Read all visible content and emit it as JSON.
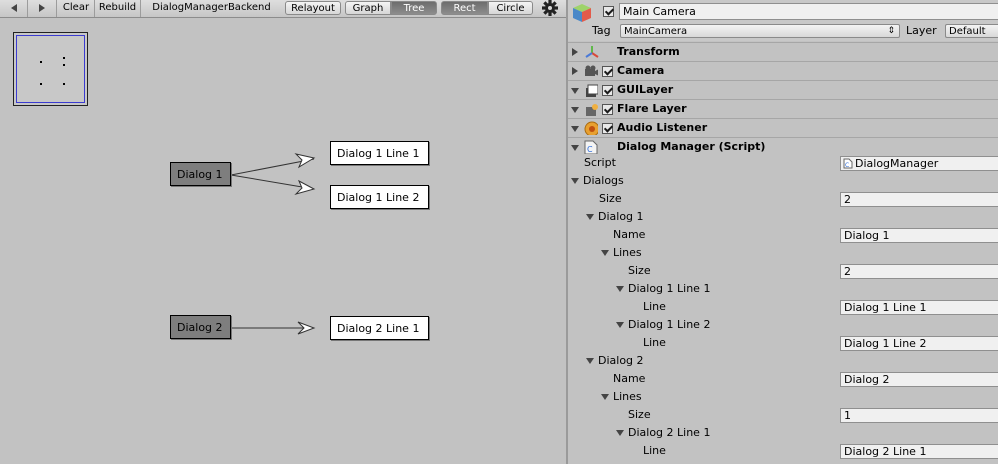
{
  "toolbar": {
    "back_icon": "triangle-left-icon",
    "forward_icon": "triangle-right-icon",
    "clear_label": "Clear",
    "rebuild_label": "Rebuild",
    "backend_label": "DialogManagerBackend",
    "relayout_label": "Relayout",
    "graph_label": "Graph",
    "tree_label": "Tree",
    "rect_label": "Rect",
    "circle_label": "Circle",
    "settings_icon": "gear-icon"
  },
  "graph": {
    "nodes": {
      "dialog1": "Dialog 1",
      "dialog1_line1": "Dialog 1 Line 1",
      "dialog1_line2": "Dialog 1 Line 2",
      "dialog2": "Dialog 2",
      "dialog2_line1": "Dialog 2 Line 1"
    }
  },
  "inspector": {
    "object_name": "Main Camera",
    "tag_label": "Tag",
    "tag_value": "MainCamera",
    "layer_label": "Layer",
    "layer_value": "Default",
    "components": {
      "transform": "Transform",
      "camera": "Camera",
      "guilayer": "GUILayer",
      "flare": "Flare Layer",
      "audio": "Audio Listener",
      "script": "Dialog Manager (Script)"
    },
    "props": {
      "script_label": "Script",
      "script_value": "DialogManager",
      "dialogs_label": "Dialogs",
      "size_label": "Size",
      "dialogs_size": "2",
      "dialog1_label": "Dialog 1",
      "name_label": "Name",
      "dialog1_name": "Dialog 1",
      "lines_label": "Lines",
      "dialog1_lines_size": "2",
      "d1l1_label": "Dialog 1 Line 1",
      "line_label": "Line",
      "d1l1_value": "Dialog 1 Line 1",
      "d1l2_label": "Dialog 1 Line 2",
      "d1l2_value": "Dialog 1 Line 2",
      "dialog2_label": "Dialog 2",
      "dialog2_name": "Dialog 2",
      "dialog2_lines_size": "1",
      "d2l1_label": "Dialog 2 Line 1",
      "d2l1_value": "Dialog 2 Line 1"
    }
  }
}
